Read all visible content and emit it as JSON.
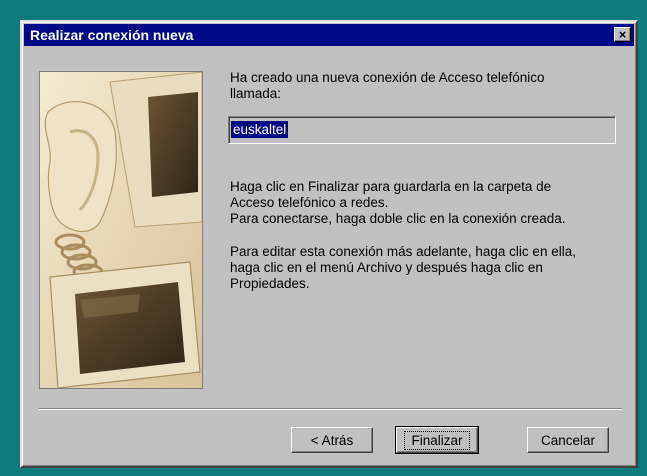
{
  "window": {
    "title": "Realizar conexión nueva",
    "close_glyph": "×"
  },
  "content": {
    "created_text": "Ha creado una nueva conexión de Acceso telefónico\nllamada:",
    "connection_name": "euskaltel",
    "save_text": "Haga clic en Finalizar para guardarla en la carpeta de\nAcceso telefónico a redes.\nPara conectarse, haga doble clic en la conexión creada.",
    "edit_text": "Para editar esta conexión más adelante, haga clic en ella,\nhaga clic en el menú Archivo y después haga clic en\nPropiedades."
  },
  "buttons": {
    "back_label": "< Atrás",
    "finish_label": "Finalizar",
    "cancel_label": "Cancelar"
  },
  "colors": {
    "desktop": "#0f7c7c",
    "titlebar": "#000a84",
    "face": "#c0c0c0"
  }
}
